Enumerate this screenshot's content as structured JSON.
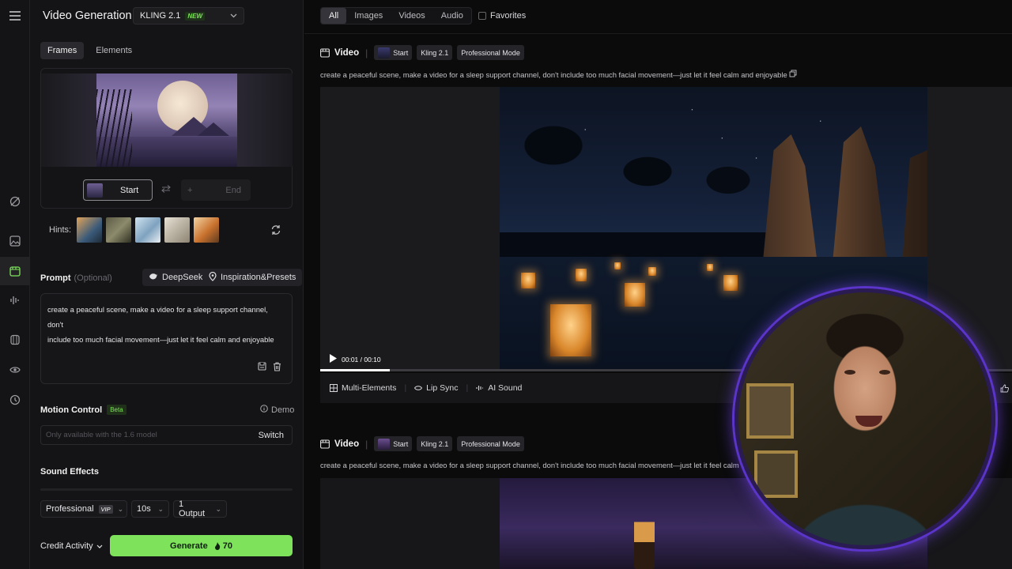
{
  "app": {
    "title": "Video Generation",
    "model": "KLING 2.1",
    "model_badge": "NEW",
    "accent": "#7ee35b"
  },
  "rail": {
    "items": [
      {
        "icon": "menu-icon"
      },
      {
        "icon": "no-brush-icon"
      },
      {
        "icon": "image-icon"
      },
      {
        "icon": "video-icon",
        "active": true
      },
      {
        "icon": "audio-wave-icon"
      },
      {
        "icon": "shirt-icon"
      },
      {
        "icon": "eye-icon"
      },
      {
        "icon": "history-icon"
      }
    ]
  },
  "panel": {
    "tabs": [
      "Frames",
      "Elements"
    ],
    "start_label": "Start",
    "end_label": "End",
    "end_plus": "+",
    "hints_label": "Hints:",
    "prompt_label": "Prompt",
    "prompt_optional": "(Optional)",
    "deepseek_label": "DeepSeek",
    "inspiration_label": "Inspiration&Presets",
    "prompt_line1": "create a peaceful scene, make a video for a sleep support channel, don't",
    "prompt_line2": "include too much facial movement—just let it feel calm and enjoyable",
    "motion_label": "Motion Control",
    "beta": "Beta",
    "demo": "Demo",
    "motion_placeholder": "Only available with the 1.6 model",
    "switch": "Switch",
    "sound_label": "Sound Effects",
    "mode": "Professional",
    "vip": "VIP",
    "duration": "10s",
    "outputs": "1 Output",
    "credit": "Credit Activity",
    "generate": "Generate",
    "cost": "70"
  },
  "main": {
    "filters": [
      "All",
      "Images",
      "Videos",
      "Audio"
    ],
    "favorites": "Favorites",
    "cards": [
      {
        "title": "Video",
        "start": "Start",
        "model": "Kling 2.1",
        "mode": "Professional Mode",
        "prompt": "create a peaceful scene, make a video for a sleep support channel, don't include too much facial movement—just let it feel calm and enjoyable",
        "time": "00:01 / 00:10",
        "progress_fraction": 0.1
      },
      {
        "title": "Video",
        "start": "Start",
        "model": "Kling 2.1",
        "mode": "Professional Mode",
        "prompt": "create a peaceful scene, make a video for a sleep support channel, don't include too much facial movement—just let it feel calm and enj"
      }
    ],
    "tools": [
      "Multi-Elements",
      "Lip Sync",
      "AI Sound"
    ]
  }
}
